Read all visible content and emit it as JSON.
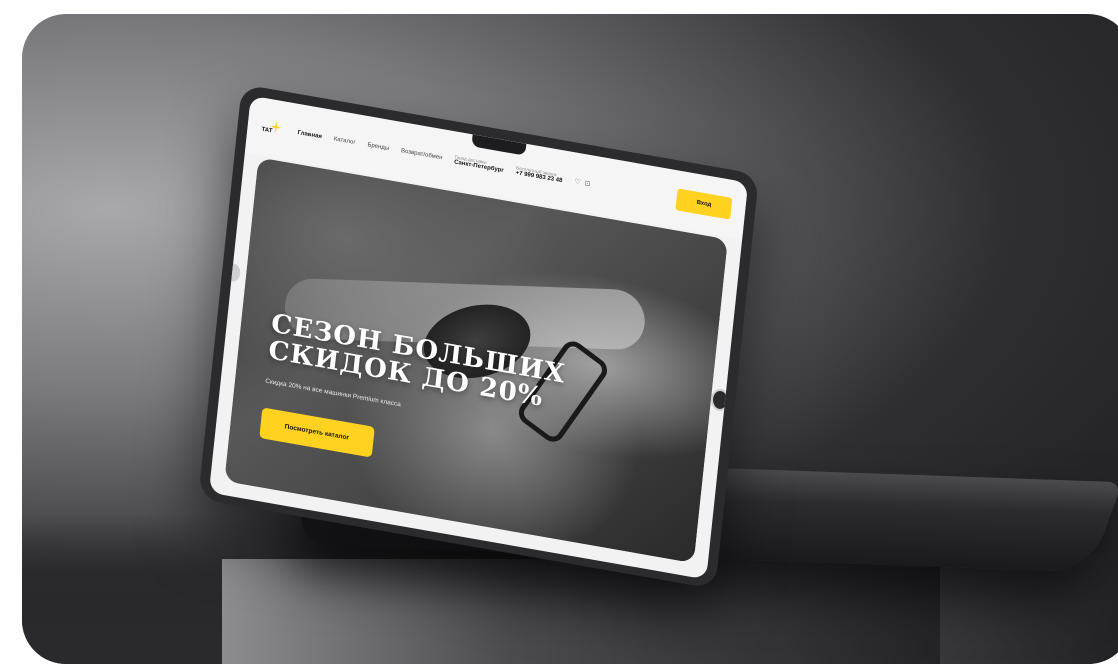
{
  "colors": {
    "accent": "#ffd21f",
    "background": "#1a1a1e",
    "laptop": "#2b2b2e"
  },
  "site": {
    "logo_text": "ТАТ",
    "nav": {
      "items": [
        "Главная",
        "Каталог",
        "Бренды",
        "Возврат/обмен"
      ],
      "location_label": "Город доставки",
      "location_value": "Санкт-Петербург",
      "phone_label": "Бесплатный звонок",
      "phone_value": "+7 999 983 23 48",
      "icons": [
        "heart-icon",
        "cart-icon"
      ],
      "login_label": "Вход"
    },
    "hero": {
      "title": "СЕЗОН БОЛЬШИХ СКИДОК ДО 20%",
      "subtitle": "Скидка 20% на все машинки Premium класса",
      "cta_label": "Посмотреть каталог"
    }
  }
}
